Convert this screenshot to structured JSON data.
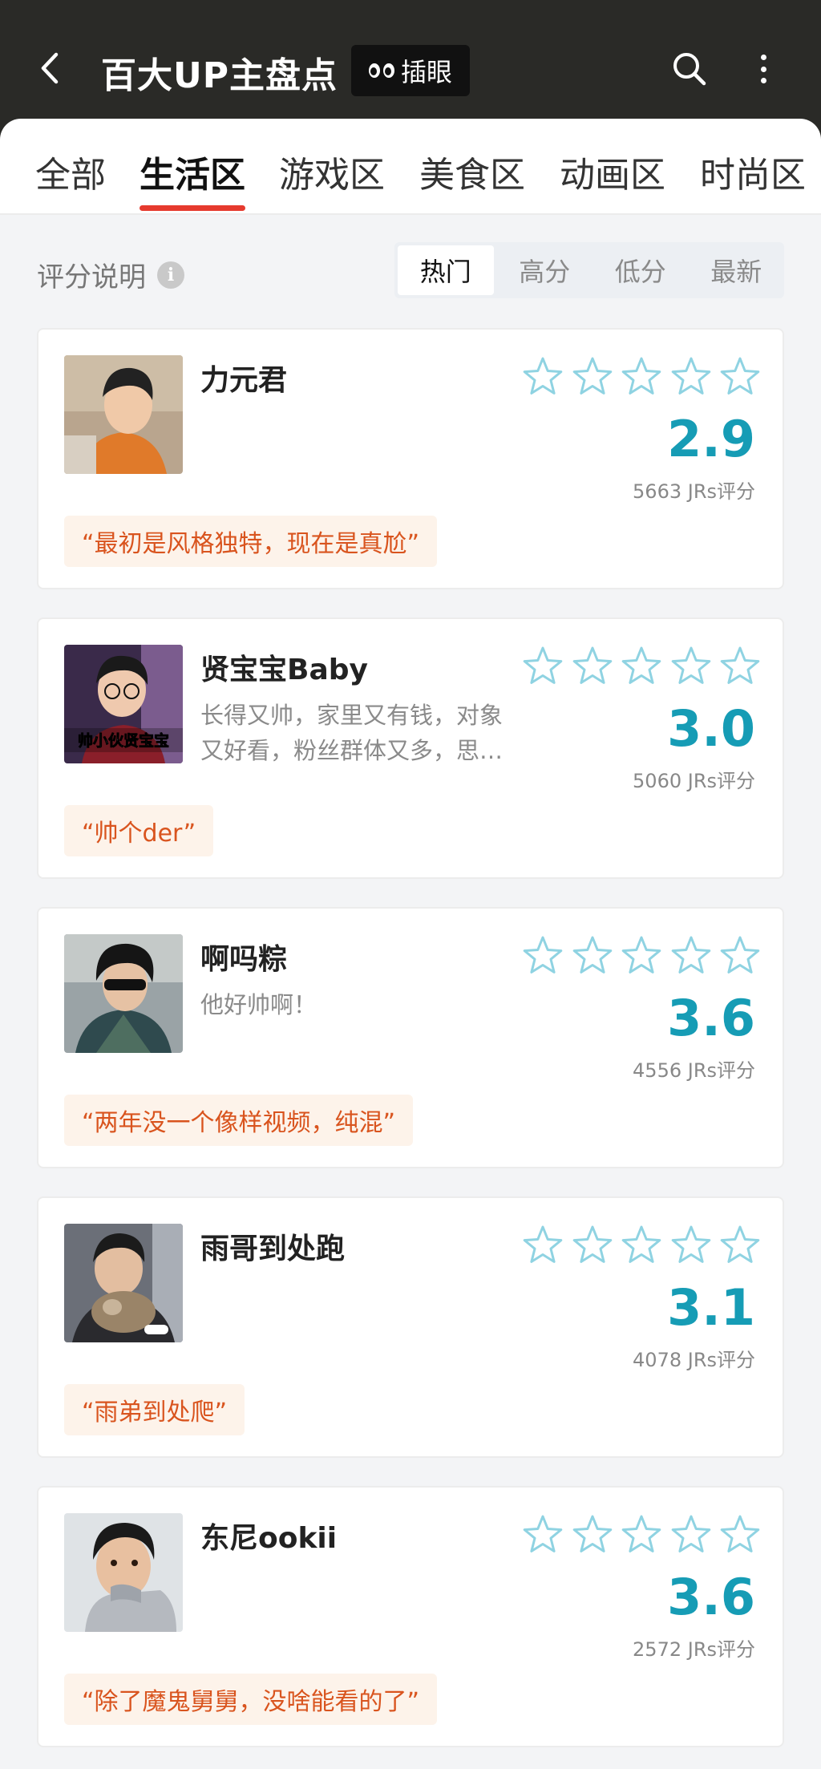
{
  "header": {
    "title": "百大UP主盘点",
    "peek_label": "插眼"
  },
  "tabs": [
    "全部",
    "生活区",
    "游戏区",
    "美食区",
    "动画区",
    "时尚区"
  ],
  "active_tab": "生活区",
  "toolbar": {
    "rating_info_label": "评分说明",
    "sort_options": [
      "热门",
      "高分",
      "低分",
      "最新"
    ],
    "active_sort": "热门"
  },
  "colors": {
    "accent_red": "#e63a2e",
    "score_teal": "#169cb5",
    "star_outline": "#8fd3e2",
    "quote_text": "#d9541e",
    "quote_bg": "#fdf3ea"
  },
  "cards": [
    {
      "name": "力元君",
      "description": "",
      "stars_filled": 0,
      "score": "2.9",
      "ratings": "5663 JRs评分",
      "quote": "“最初是风格独特，现在是真尬”"
    },
    {
      "name": "贤宝宝Baby",
      "description": "长得又帅，家里又有钱，对象又好看，粉丝群体又多，思…",
      "stars_filled": 0,
      "score": "3.0",
      "ratings": "5060 JRs评分",
      "quote": "“帅个der”",
      "avatar_caption": "帅小伙贤宝宝"
    },
    {
      "name": "啊吗粽",
      "description": "他好帅啊！",
      "stars_filled": 0,
      "score": "3.6",
      "ratings": "4556 JRs评分",
      "quote": "“两年没一个像样视频，纯混”"
    },
    {
      "name": "雨哥到处跑",
      "description": "",
      "stars_filled": 0,
      "score": "3.1",
      "ratings": "4078 JRs评分",
      "quote": "“雨弟到处爬”"
    },
    {
      "name": "东尼ookii",
      "description": "",
      "stars_filled": 0,
      "score": "3.6",
      "ratings": "2572 JRs评分",
      "quote": "“除了魔鬼舅舅，没啥能看的了”"
    }
  ]
}
